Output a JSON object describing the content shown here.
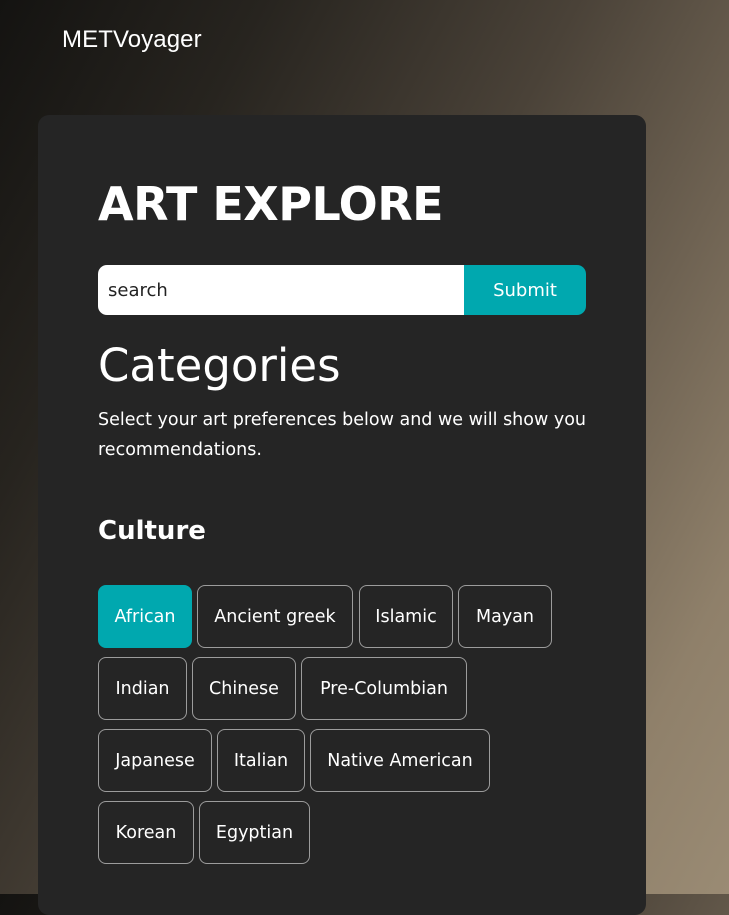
{
  "brand": "METVoyager",
  "page": {
    "title": "ART EXPLORE",
    "search": {
      "placeholder": "search",
      "submit_label": "Submit"
    },
    "categories_heading": "Categories",
    "description": "Select your art preferences below and we will show you recommendations.",
    "culture": {
      "heading": "Culture",
      "accent_color": "#00a8af",
      "chips": [
        {
          "label": "African",
          "selected": true
        },
        {
          "label": "Ancient greek",
          "selected": false
        },
        {
          "label": "Islamic",
          "selected": false
        },
        {
          "label": "Mayan",
          "selected": false
        },
        {
          "label": "Indian",
          "selected": false
        },
        {
          "label": "Chinese",
          "selected": false
        },
        {
          "label": "Pre-Columbian",
          "selected": false
        },
        {
          "label": "Japanese",
          "selected": false
        },
        {
          "label": "Italian",
          "selected": false
        },
        {
          "label": "Native American",
          "selected": false
        },
        {
          "label": "Korean",
          "selected": false
        },
        {
          "label": "Egyptian",
          "selected": false
        }
      ]
    }
  }
}
